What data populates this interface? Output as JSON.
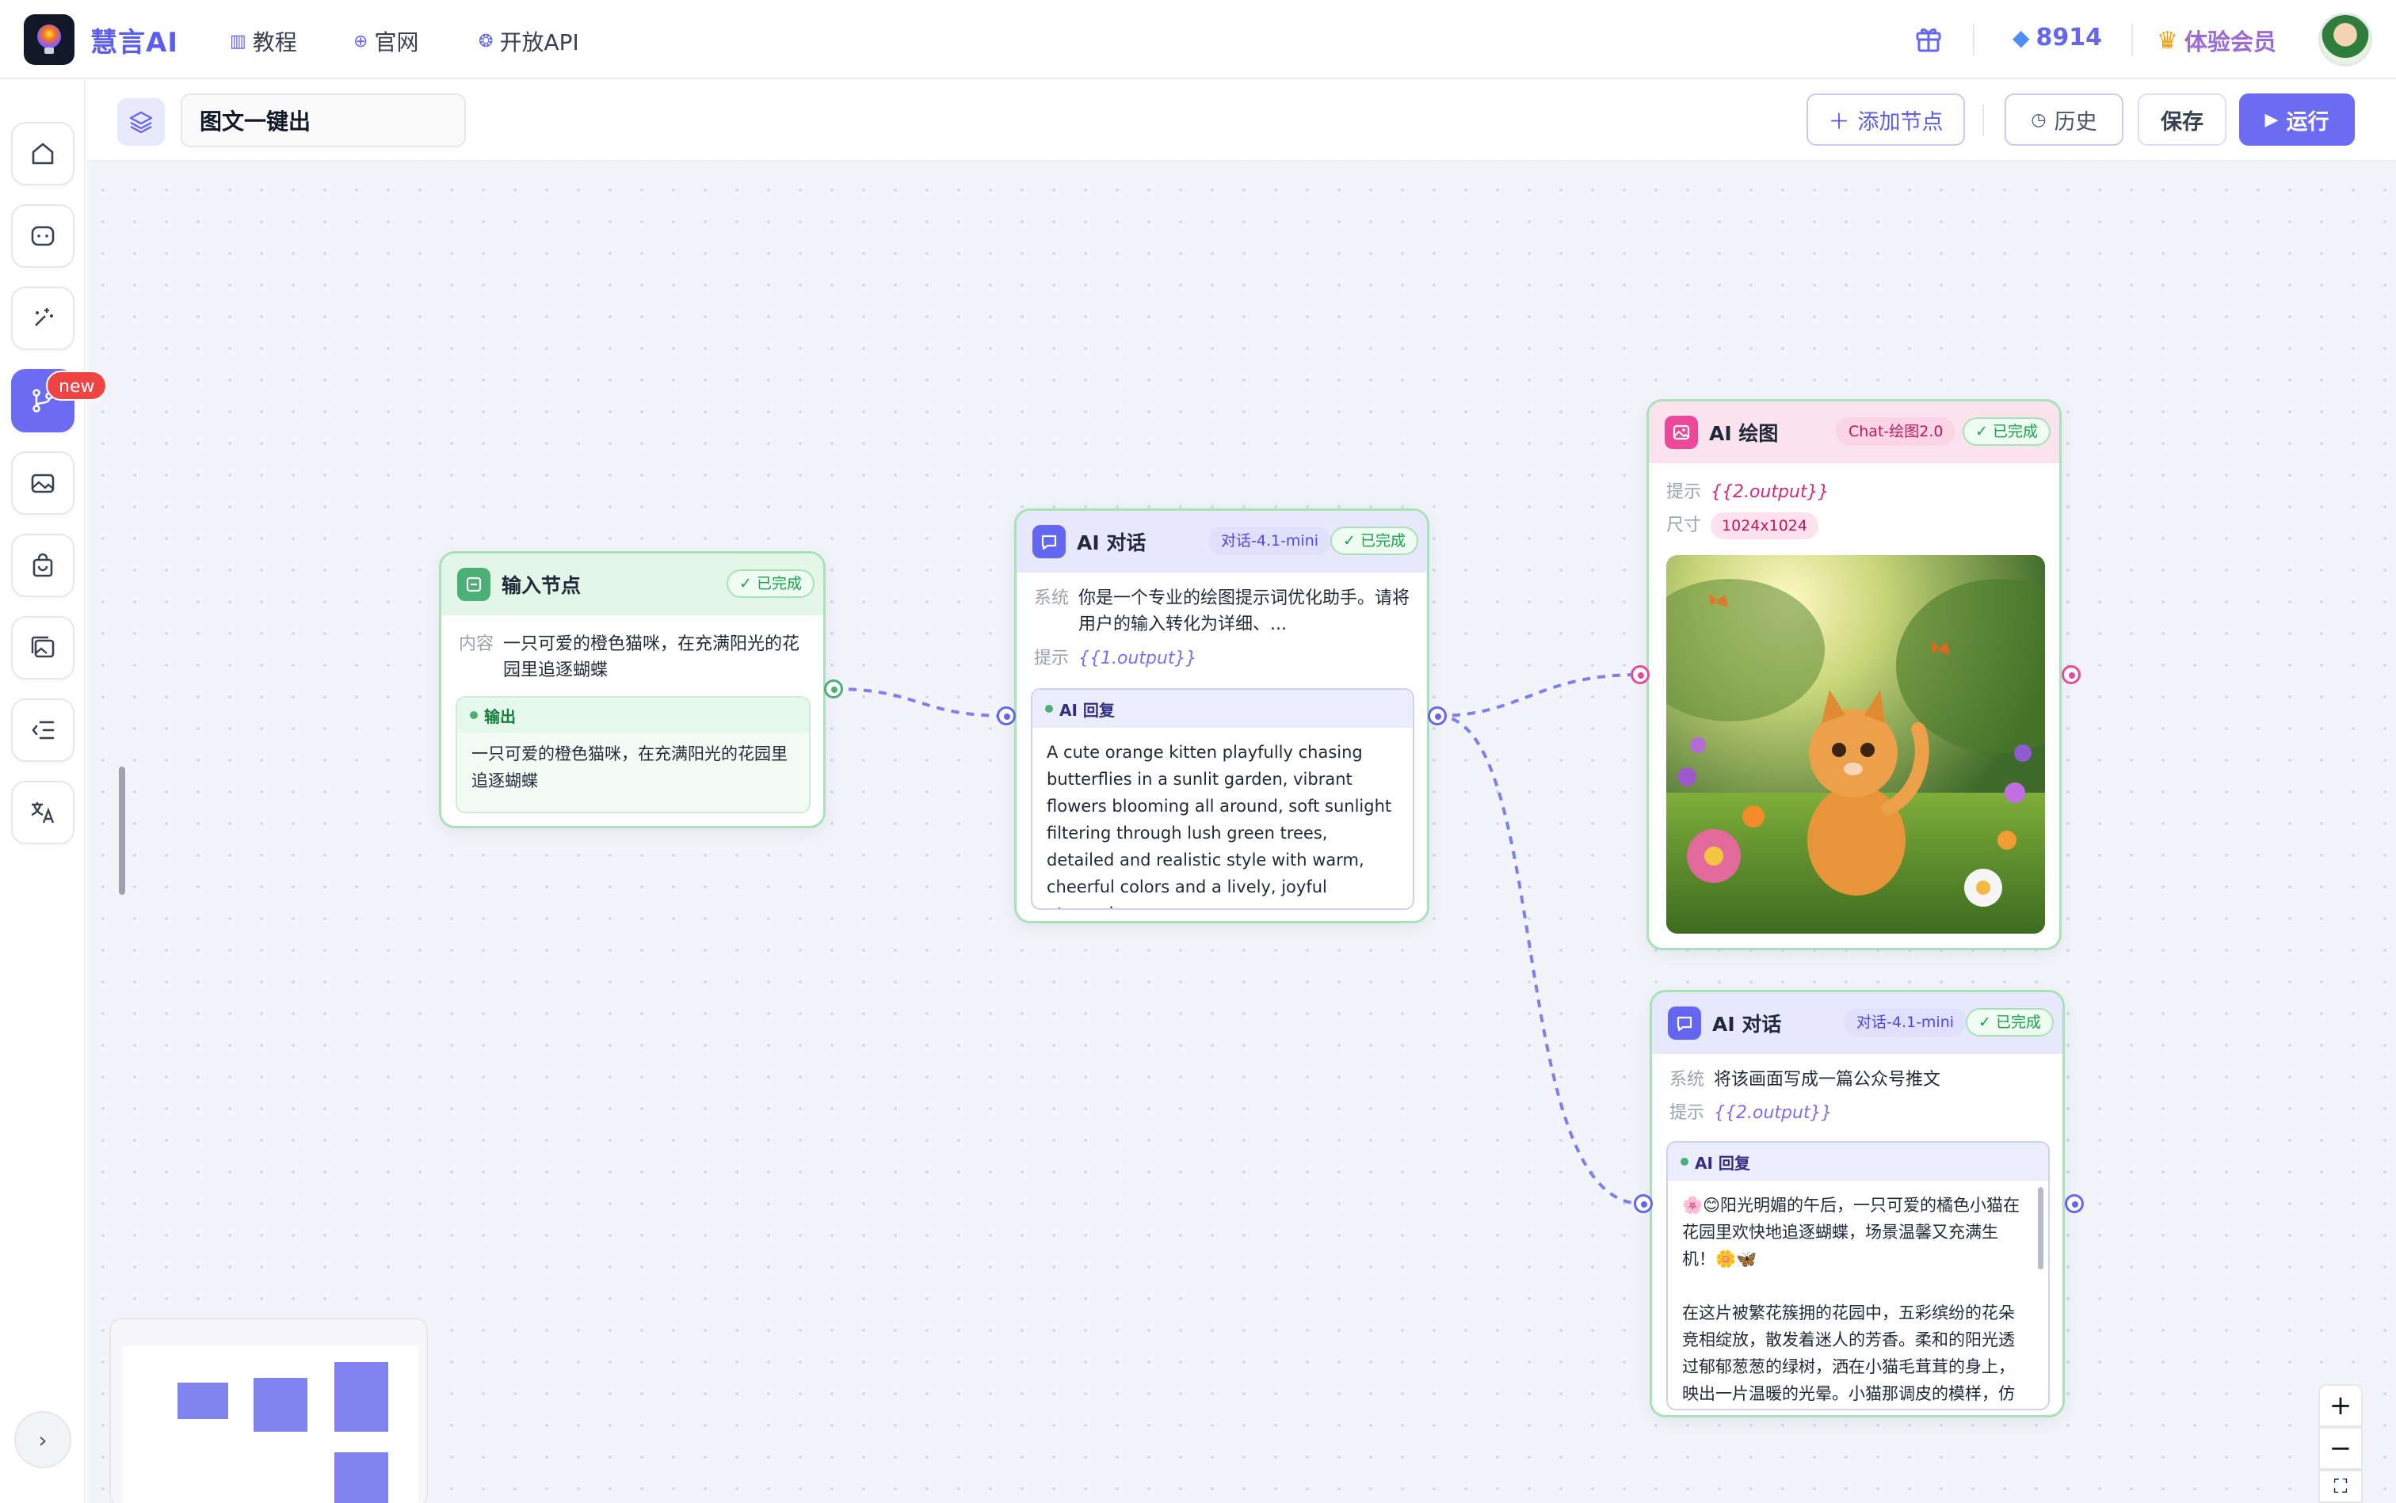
{
  "nav": {
    "brand": "慧言AI",
    "links": [
      {
        "icon": "book-icon",
        "label": "教程"
      },
      {
        "icon": "globe-icon",
        "label": "官网"
      },
      {
        "icon": "api-icon",
        "label": "开放API"
      }
    ],
    "points": "8914",
    "vip_label": "体验会员"
  },
  "sidebar": {
    "items": [
      "home-icon",
      "chat-icon",
      "magic-wand-icon",
      "workflow-icon",
      "image-gallery-icon",
      "shopping-bag-icon",
      "photos-icon",
      "outline-list-icon",
      "translate-icon"
    ],
    "active_index": 3,
    "new_badge": "new"
  },
  "toolbar": {
    "title": "图文一键出",
    "add_node": "添加节点",
    "history": "历史",
    "save": "保存",
    "run": "运行"
  },
  "nodes": {
    "input": {
      "title": "输入节点",
      "status": "已完成",
      "content_label": "内容",
      "content": "一只可爱的橙色猫咪，在充满阳光的花园里追逐蝴蝶",
      "output_label": "输出",
      "output": "一只可爱的橙色猫咪，在充满阳光的花园里追逐蝴蝶"
    },
    "chat1": {
      "title": "AI 对话",
      "model": "对话-4.1-mini",
      "status": "已完成",
      "system_label": "系统",
      "system": "你是一个专业的绘图提示词优化助手。请将用户的输入转化为详细、...",
      "prompt_label": "提示",
      "prompt": "{{1.output}}",
      "reply_label": "AI 回复",
      "reply": "A cute orange kitten playfully chasing butterflies in a sunlit garden, vibrant flowers blooming all around, soft sunlight filtering through lush green trees, detailed and realistic style with warm, cheerful colors and a lively, joyful atmosphere."
    },
    "draw": {
      "title": "AI 绘图",
      "model": "Chat-绘图2.0",
      "status": "已完成",
      "prompt_label": "提示",
      "prompt": "{{2.output}}",
      "size_label": "尺寸",
      "size": "1024x1024"
    },
    "chat2": {
      "title": "AI 对话",
      "model": "对话-4.1-mini",
      "status": "已完成",
      "system_label": "系统",
      "system": "将该画面写成一篇公众号推文",
      "prompt_label": "提示",
      "prompt": "{{2.output}}",
      "reply_label": "AI 回复",
      "reply_p1": "🌸😊阳光明媚的午后，一只可爱的橘色小猫在花园里欢快地追逐蝴蝶，场景温馨又充满生机！🌼🦋",
      "reply_p2": "在这片被繁花簇拥的花园中，五彩缤纷的花朵竞相绽放，散发着迷人的芳香。柔和的阳光透过郁郁葱葱的绿树，洒在小猫毛茸茸的身上，映出一片温暖的光晕。小猫那调皮的模样，仿"
    }
  },
  "colors": {
    "accent": "#6b6cf1",
    "success": "#16a34a",
    "pink": "#db2777"
  }
}
